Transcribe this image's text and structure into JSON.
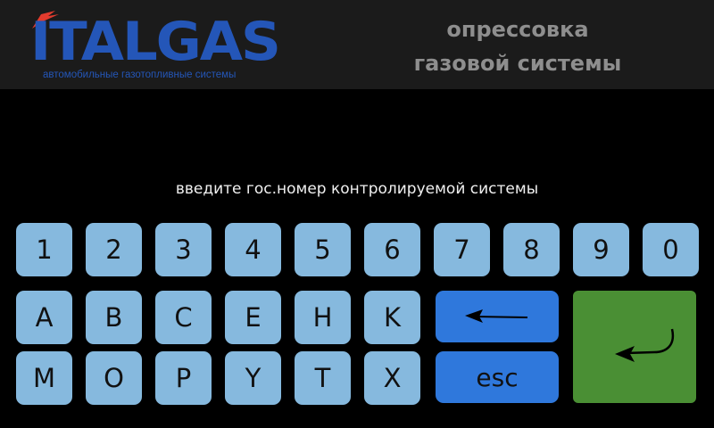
{
  "header": {
    "logo_text": "ITALGAS",
    "logo_subtitle": "автомобильные газотопливные системы",
    "title_line1": "опрессовка",
    "title_line2": "газовой системы"
  },
  "prompt": "введите гос.номер контролируемой системы",
  "keyboard": {
    "row1": [
      "1",
      "2",
      "3",
      "4",
      "5",
      "6",
      "7",
      "8",
      "9",
      "0"
    ],
    "row2": [
      "A",
      "B",
      "C",
      "E",
      "H",
      "K"
    ],
    "row3": [
      "M",
      "O",
      "P",
      "Y",
      "T",
      "X"
    ],
    "esc_label": "esc",
    "backspace_icon": "left-arrow-icon",
    "enter_icon": "enter-arrow-icon"
  },
  "colors": {
    "key": "#86b9de",
    "action_key": "#2f78dc",
    "enter_key": "#4a8f34",
    "brand": "#2456b8"
  }
}
